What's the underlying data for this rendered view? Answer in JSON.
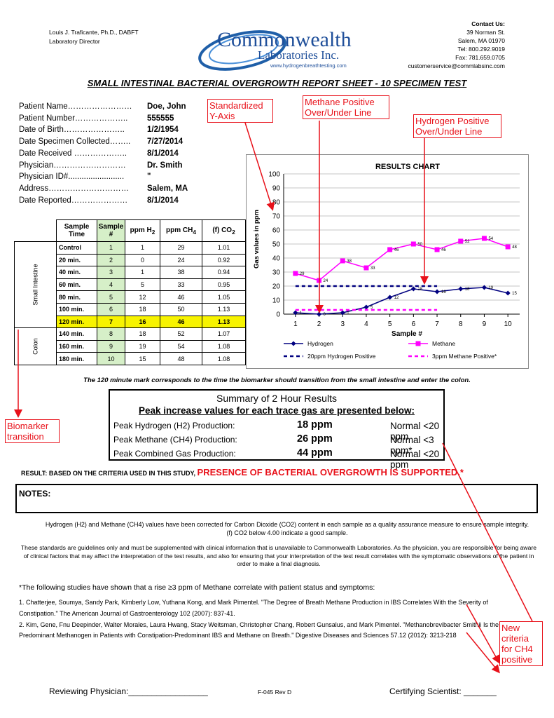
{
  "header": {
    "left_line1": "Louis J. Traficante, Ph.D., DABFT",
    "left_line2": "Laboratory Director",
    "contact_title": "Contact Us:",
    "contact_lines": [
      "39 Norman St.",
      "Salem, MA 01970",
      "Tel: 800.292.9019",
      "Fax: 781.659.0705",
      "customerservice@commlabsinc.com"
    ],
    "logo_main": "Commonwealth",
    "logo_sub": "Laboratories Inc.",
    "logo_url": "www.hydrogenbreathtesting.com"
  },
  "title": "SMALL INTESTINAL BACTERIAL OVERGROWTH REPORT SHEET - 10 SPECIMEN TEST",
  "patient": [
    {
      "label": "Patient Name……………………",
      "value": "Doe, John"
    },
    {
      "label": "Patient Number………………..",
      "value": "555555"
    },
    {
      "label": "Date of Birth…………………..",
      "value": "1/2/1954"
    },
    {
      "label": "Date Specimen Collected……..",
      "value": "7/27/2014"
    },
    {
      "label": "Date Received ………………..",
      "value": "8/1/2014"
    },
    {
      "label": "Physician………………………",
      "value": "Dr. Smith"
    },
    {
      "label": "Physician ID#.........................",
      "value": "\""
    },
    {
      "label": "Address…………………………",
      "value": "Salem, MA"
    },
    {
      "label": "Date Reported…………………",
      "value": "8/1/2014"
    }
  ],
  "table": {
    "headers": [
      "Sample Time",
      "Sample #",
      "ppm H2",
      "ppm CH4",
      "(f) CO2"
    ],
    "side_labels": [
      "Small Intestine",
      "Colon"
    ],
    "rows": [
      [
        "Control",
        "1",
        "1",
        "29",
        "1.01"
      ],
      [
        "20 min.",
        "2",
        "0",
        "24",
        "0.92"
      ],
      [
        "40 min.",
        "3",
        "1",
        "38",
        "0.94"
      ],
      [
        "60 min.",
        "4",
        "5",
        "33",
        "0.95"
      ],
      [
        "80 min.",
        "5",
        "12",
        "46",
        "1.05"
      ],
      [
        "100 min.",
        "6",
        "18",
        "50",
        "1.13"
      ],
      [
        "120 min.",
        "7",
        "16",
        "46",
        "1.13"
      ],
      [
        "140 min.",
        "8",
        "18",
        "52",
        "1.07"
      ],
      [
        "160 min.",
        "9",
        "19",
        "54",
        "1.08"
      ],
      [
        "180 min.",
        "10",
        "15",
        "48",
        "1.08"
      ]
    ]
  },
  "chart_data": {
    "type": "line",
    "title": "RESULTS CHART",
    "xlabel": "Sample #",
    "ylabel": "Gas values in ppm",
    "x": [
      1,
      2,
      3,
      4,
      5,
      6,
      7,
      8,
      9,
      10
    ],
    "ylim": [
      0,
      100
    ],
    "yticks": [
      0,
      10,
      20,
      30,
      40,
      50,
      60,
      70,
      80,
      90,
      100
    ],
    "grid": true,
    "series": [
      {
        "name": "Hydrogen",
        "values": [
          1,
          0,
          1,
          5,
          12,
          18,
          16,
          18,
          19,
          15
        ],
        "color": "#000080",
        "labels": [
          "1",
          "0",
          "1",
          "5",
          "12",
          "18",
          "16",
          "18",
          "19",
          "15"
        ]
      },
      {
        "name": "Methane",
        "values": [
          29,
          24,
          38,
          33,
          46,
          50,
          46,
          52,
          54,
          48
        ],
        "color": "#ff00ff",
        "labels": [
          "29",
          "24",
          "38",
          "33",
          "46",
          "50",
          "46",
          "52",
          "54",
          "48"
        ]
      },
      {
        "name": "20ppm Hydrogen Positive",
        "x": [
          1,
          7
        ],
        "values": [
          20,
          20
        ],
        "color": "#000080",
        "dashed": true
      },
      {
        "name": "3ppm Methane Positive*",
        "x": [
          1,
          7
        ],
        "values": [
          3,
          3
        ],
        "color": "#ff00ff",
        "dashed": true
      }
    ],
    "legend": "bottom"
  },
  "note_120": "The 120 minute mark corresponds to the time the biomarker should transition from the small intestine and enter the colon.",
  "summary": {
    "title": "Summary of 2 Hour Results",
    "subtitle": "Peak increase values for each trace gas are presented below:",
    "rows": [
      {
        "label": "Peak Hydrogen (H2) Production:",
        "value": "18  ppm",
        "normal": "Normal <20 ppm"
      },
      {
        "label": "Peak Methane (CH4) Production:",
        "value": "26  ppm",
        "normal": "Normal <3 ppm*"
      },
      {
        "label": "Peak Combined Gas Production:",
        "value": "44  ppm",
        "normal": "Normal <20 ppm"
      }
    ]
  },
  "result": {
    "prefix": "RESULT: BASED ON THE CRITERIA USED IN THIS STUDY,",
    "text": "PRESENCE OF BACTERIAL OVERGROWTH IS SUPPORTED.*"
  },
  "notes_label": "NOTES:",
  "correction_text": "Hydrogen (H2) and Methane (CH4) values have been corrected for Carbon Dioxide (CO2) content in each sample as a quality assurance measure to ensure sample integrity.  (f) CO2  below 4.00 indicate a good sample.",
  "standards_text": "These standards are guidelines only and must be supplemented with clinical information that is unavailable to Commonwealth Laboratories. As the physician, you are responsible for being aware of clinical factors that may affect the interpretation of the test results, and also for ensuring that your interpretation of the test result correlates with the symptomatic observations of the patient in order to make a final diagnosis.",
  "studies_intro": "*The following studies have shown that a rise ≥3 ppm of Methane correlate with patient status and symptoms:",
  "references": [
    "1. Chatterjee, Soumya, Sandy Park, Kimberly Low, Yuthana Kong, and Mark Pimentel. \"The Degree of Breath Methane Production in IBS Correlates With the Severity of Constipation.\" The American Journal of Gastroenterology 102 (2007): 837-41.",
    "2. Kim, Gene, Fnu Deepinder, Walter Morales, Laura Hwang, Stacy Weitsman, Christopher Chang, Robert Gunsalus, and Mark Pimentel. \"Methanobrevibacter Smithii Is the Predominant Methanogen in Patients with Constipation-Predominant IBS and Methane on Breath.\" Digestive Diseases and Sciences 57.12 (2012): 3213-218"
  ],
  "footer": {
    "reviewing": "Reviewing Physician:_________________",
    "form": "F-045 Rev D",
    "certifying": "Certifying Scientist: _______"
  },
  "annotations": {
    "y_axis": "Standardized Y-Axis",
    "methane_line": "Methane Positive Over/Under Line",
    "hydrogen_line": "Hydrogen Positive Over/Under Line",
    "biomarker": "Biomarker transition",
    "new_criteria": "New criteria for CH4 positive",
    "color": "#e8111a"
  }
}
